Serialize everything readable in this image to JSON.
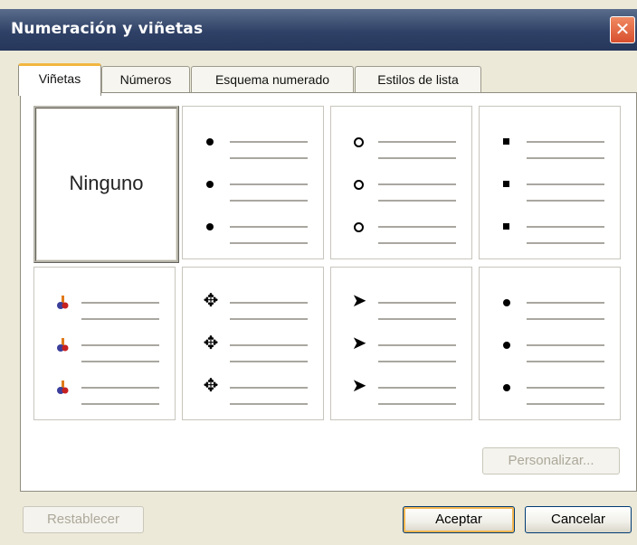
{
  "window": {
    "title": "Numeración y viñetas",
    "close_symbol": "✕"
  },
  "tabs": [
    {
      "label": "Viñetas",
      "active": true
    },
    {
      "label": "Números",
      "active": false
    },
    {
      "label": "Esquema numerado",
      "active": false
    },
    {
      "label": "Estilos de lista",
      "active": false
    }
  ],
  "gallery": {
    "none_label": "Ninguno",
    "styles": [
      "ninguno",
      "dot",
      "hollow-circle",
      "square",
      "pushpin-icon",
      "four-diamond",
      "arrowhead",
      "dot"
    ],
    "selected_index": 0
  },
  "buttons": {
    "customize_label": "Personalizar...",
    "reset_label": "Restablecer",
    "ok_label": "Aceptar",
    "cancel_label": "Cancelar"
  },
  "glyphs": {
    "four_diamond": "✥",
    "arrowhead": "➤"
  }
}
